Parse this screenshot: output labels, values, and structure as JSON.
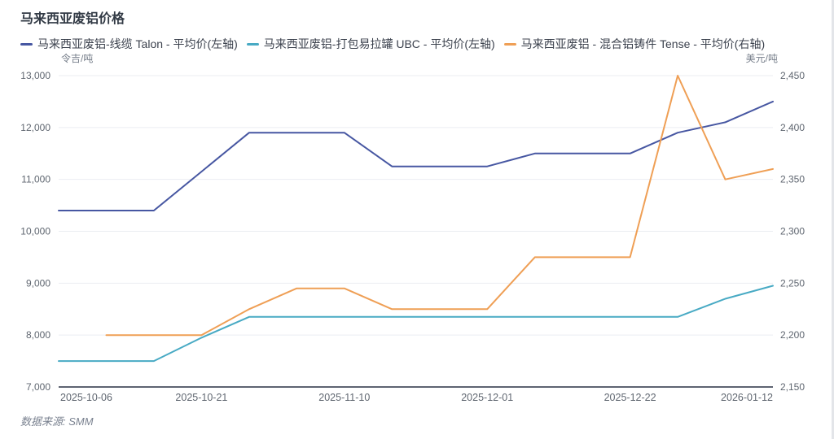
{
  "chart_data": {
    "type": "line",
    "title": "马来西亚废铝价格",
    "source": "数据来源: SMM",
    "x_count": 16,
    "x_tick_labels": [
      {
        "index": 0,
        "label": "2025-10-06"
      },
      {
        "index": 3,
        "label": "2025-10-21"
      },
      {
        "index": 6,
        "label": "2025-11-10"
      },
      {
        "index": 9,
        "label": "2025-12-01"
      },
      {
        "index": 12,
        "label": "2025-12-22"
      },
      {
        "index": 15,
        "label": "2026-01-12"
      }
    ],
    "left_axis": {
      "name": "令吉/吨",
      "min": 7000,
      "max": 13000,
      "ticks": [
        13000,
        12000,
        11000,
        10000,
        9000,
        8000,
        7000
      ]
    },
    "right_axis": {
      "name": "美元/吨",
      "min": 2150,
      "max": 2450,
      "ticks": [
        2450,
        2400,
        2350,
        2300,
        2250,
        2200,
        2150
      ]
    },
    "grid": true,
    "legend_position": "top",
    "series": [
      {
        "name": "马来西亚废铝-线缆 Talon - 平均价(左轴)",
        "axis": "left",
        "color": "#4757a2",
        "values": [
          10400,
          10400,
          10400,
          11150,
          11900,
          11900,
          11900,
          11250,
          11250,
          11250,
          11500,
          11500,
          11500,
          11900,
          12100,
          12500
        ]
      },
      {
        "name": "马来西亚废铝-打包易拉罐 UBC - 平均价(左轴)",
        "axis": "left",
        "color": "#48aac4",
        "values": [
          7500,
          7500,
          7500,
          7950,
          8350,
          8350,
          8350,
          8350,
          8350,
          8350,
          8350,
          8350,
          8350,
          8350,
          8700,
          8950
        ]
      },
      {
        "name": "马来西亚废铝 - 混合铝铸件 Tense - 平均价(右轴)",
        "axis": "right",
        "color": "#ef9f55",
        "values": [
          null,
          2200,
          2200,
          2200,
          2225,
          2245,
          2245,
          2225,
          2225,
          2225,
          2275,
          2275,
          2275,
          2450,
          2350,
          2360
        ]
      }
    ]
  }
}
